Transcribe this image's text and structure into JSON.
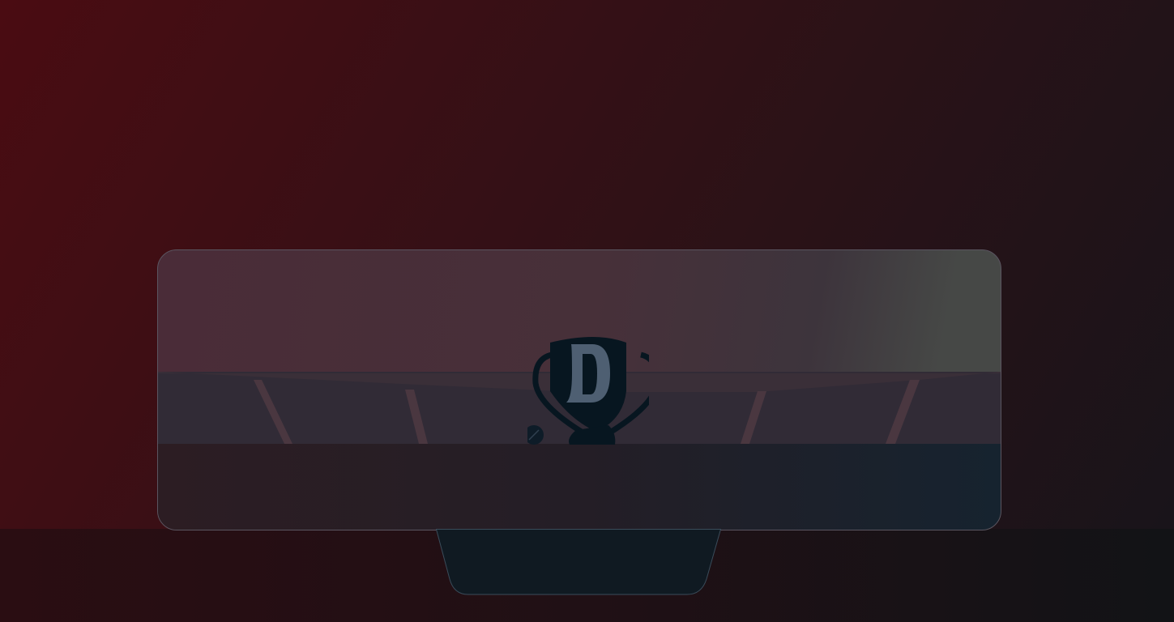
{
  "logo": {
    "letter": "D",
    "icon": "trophy-logo-icon"
  },
  "colors": {
    "background": "#3a0f15",
    "logo_dark": "#071620",
    "logo_letter": "#4e5f72",
    "panel": "#101a22"
  }
}
